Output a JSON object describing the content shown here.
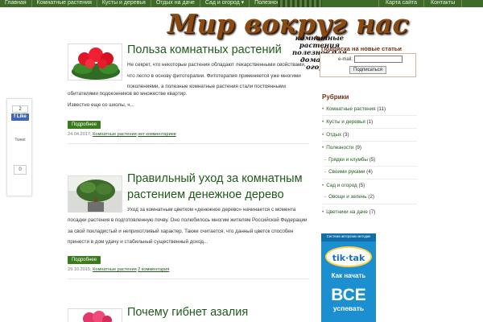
{
  "nav": {
    "items": [
      "Главная",
      "Комнатные растения",
      "Кусты и деревья",
      "Отдых на даче",
      "Сад и огород ▾",
      "Полезности ▾"
    ],
    "right_items": [
      "Карта сайта",
      "Контакты"
    ]
  },
  "header": {
    "logo": "Мир вокруг нас",
    "tagline": "комнатные растения полезное для дома сад-огород"
  },
  "social": {
    "fb_count": "2",
    "fb_like": "Like",
    "tweet": "Tweet",
    "gplus_count": "0"
  },
  "posts": [
    {
      "title": "Польза комнатных растений",
      "text": [
        "Не секрет, что некоторые растения обладают лекарственными свойствами,",
        "что легло в основу фитотерапии. Фитотерапия применяется уже многими",
        "поколениями, а полезные комнатные растения стали постоянными",
        "обитателями подоконников во множестве квартир.",
        "Известно еще со школы, ч..."
      ],
      "more": "Подробнее",
      "date": "24.04.2017,",
      "category": "Комнатные растения",
      "comments": "нет комментариев"
    },
    {
      "title": "Правильный уход за комнатным растением денежное дерево",
      "text": [
        "Уход за комнатным цветком «денежное дерево» начинается с момента",
        "посадки растения в подготовленную почву. Оно полюбилось многим жителям Российской Федерации",
        "за свой покладистый и неприхотливый характер. Также считается, что данный цветок способен",
        "принести в дом удачу и стабильный существенный доход..."
      ],
      "more": "Подробнее",
      "date": "29.10.2015,",
      "category": "Комнатные растения",
      "comments": "2 комментария"
    },
    {
      "title": "Почему гибнет азалия"
    }
  ],
  "sidebar": {
    "subscribe_title": "Подписка на новые статьи",
    "email_label": "e-mail:",
    "email_value": "",
    "subscribe_button": "Подписаться",
    "rubrics_title": "Рубрики",
    "rubrics": [
      {
        "label": "Комнатные растения",
        "count": "(11)",
        "level": 0
      },
      {
        "label": "Кусты и деревья",
        "count": "(1)",
        "level": 0
      },
      {
        "label": "Отдых",
        "count": "(3)",
        "level": 0
      },
      {
        "label": "Полезности",
        "count": "(9)",
        "level": 0
      },
      {
        "label": "Грядки и клумбы",
        "count": "(5)",
        "level": 1
      },
      {
        "label": "Своими руками",
        "count": "(4)",
        "level": 1
      },
      {
        "label": "Сад и огород",
        "count": "(5)",
        "level": 0
      },
      {
        "label": "Овощи и зелень",
        "count": "(2)",
        "level": 1
      },
      {
        "label": "Цветники на даче",
        "count": "(7)",
        "level": 0
      }
    ]
  },
  "ad": {
    "top": "Система авторских методик",
    "logo": "tik·tak",
    "line1": "Как начать",
    "big": "ВСЕ",
    "line2": "успевать"
  }
}
